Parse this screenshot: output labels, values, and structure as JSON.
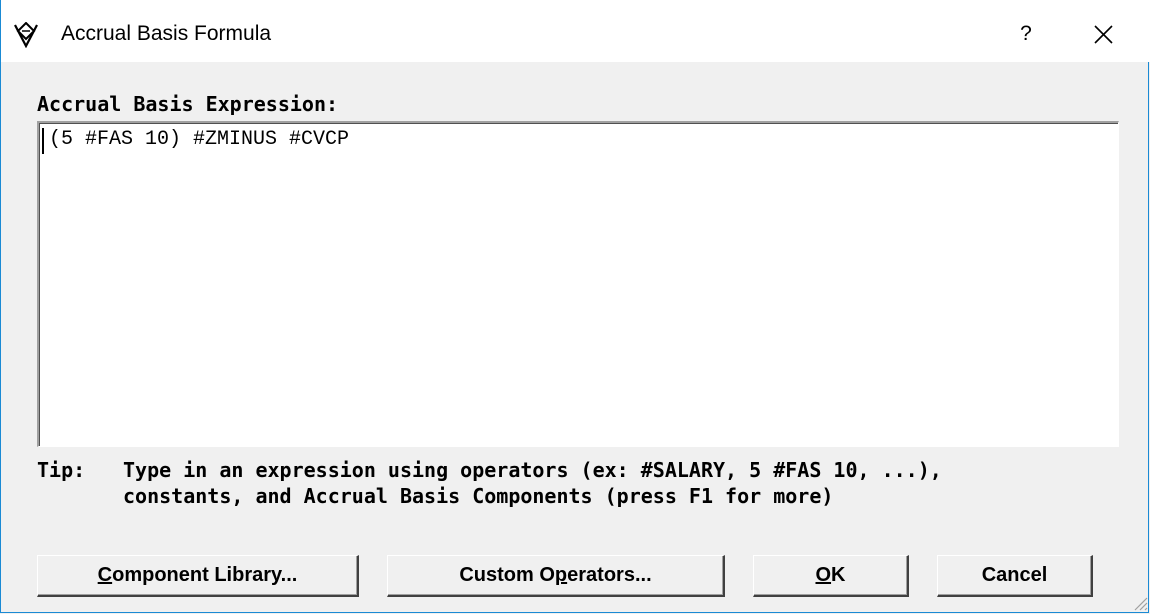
{
  "window": {
    "title": "Accrual Basis Formula",
    "help_label": "?",
    "app_icon": "vdiamond-app-icon",
    "close_icon": "close-icon"
  },
  "expression": {
    "label": "Accrual Basis Expression:",
    "value": "(5 #FAS 10) #ZMINUS #CVCP"
  },
  "tip": {
    "label": "Tip:",
    "line1": "Type in an expression using operators (ex: #SALARY, 5 #FAS 10, ...),",
    "line2": "constants, and Accrual Basis Components (press F1 for more)"
  },
  "buttons": {
    "component_library": {
      "mnemonic": "C",
      "rest": "omponent Library..."
    },
    "custom_operators": {
      "pre": "Custom O",
      "mnemonic": "p",
      "rest": "erators..."
    },
    "ok": {
      "mnemonic": "O",
      "rest": "K"
    },
    "cancel": "Cancel"
  },
  "colors": {
    "titlebar_bg": "#ffffff",
    "dialog_bg": "#f0f0f0",
    "window_border": "#1a8ad4"
  }
}
